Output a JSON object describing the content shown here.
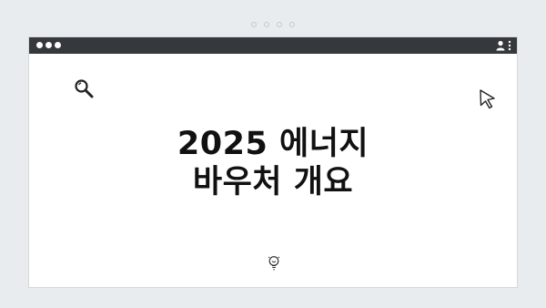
{
  "pagination": {
    "dots": 4
  },
  "window": {
    "controls": [
      "dot",
      "dot",
      "dot"
    ],
    "right_icons": [
      "user-icon",
      "kebab-menu-icon"
    ]
  },
  "content": {
    "title_line1": "2025 에너지",
    "title_line2": "바우처 개요",
    "icons": [
      "search-icon",
      "cursor-icon",
      "lightbulb-icon"
    ]
  },
  "colors": {
    "background": "#e8ecef",
    "titlebar": "#35393d",
    "window": "#ffffff",
    "text": "#111111"
  }
}
